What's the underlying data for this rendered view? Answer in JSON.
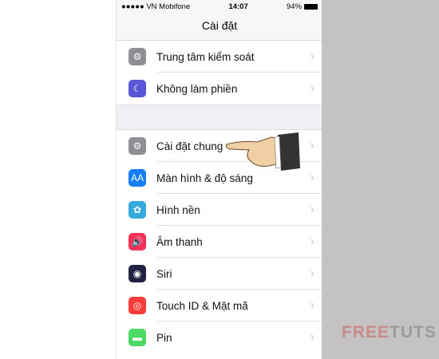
{
  "status": {
    "carrier": "●●●●● VN Mobifone",
    "time": "14:07",
    "battery": "94%"
  },
  "nav": {
    "title": "Cài đặt"
  },
  "group1": [
    {
      "label": "Trung tâm kiểm soát",
      "icon": "control-center-icon",
      "color": "#8e8e93",
      "glyph": "⚙"
    },
    {
      "label": "Không làm phiền",
      "icon": "moon-icon",
      "color": "#5856d6",
      "glyph": "☾"
    }
  ],
  "group2": [
    {
      "label": "Cài đặt chung",
      "icon": "gear-icon",
      "color": "#8e8e93",
      "glyph": "⚙"
    },
    {
      "label": "Màn hình & độ sáng",
      "icon": "display-brightness-icon",
      "color": "#147efb",
      "glyph": "AA"
    },
    {
      "label": "Hình nền",
      "icon": "wallpaper-icon",
      "color": "#35aadc",
      "glyph": "✿"
    },
    {
      "label": "Âm thanh",
      "icon": "sound-icon",
      "color": "#fc3158",
      "glyph": "🔊"
    },
    {
      "label": "Siri",
      "icon": "siri-icon",
      "color": "#222244",
      "glyph": "◉"
    },
    {
      "label": "Touch ID & Mật mã",
      "icon": "fingerprint-icon",
      "color": "#fc3d39",
      "glyph": "◎"
    },
    {
      "label": "Pin",
      "icon": "battery-icon",
      "color": "#4cd964",
      "glyph": "▬"
    }
  ],
  "chevron": "›",
  "watermark": {
    "part1": "FREE",
    "part2": "TUTS"
  }
}
